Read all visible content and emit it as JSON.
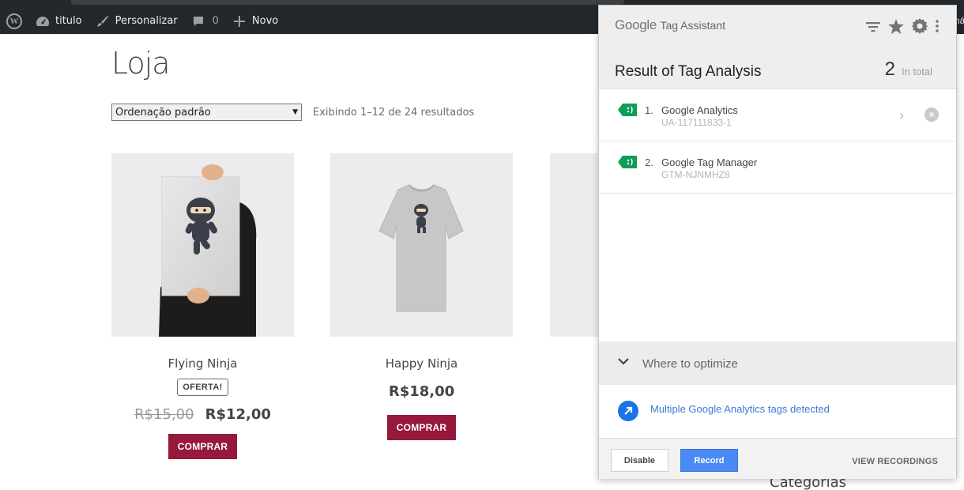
{
  "adminbar": {
    "wp_logo": "W",
    "site_label": "titulo",
    "customize_label": "Personalizar",
    "comments_count": "0",
    "new_label": "Novo",
    "right_edge_text": "ná",
    "icons": [
      "wordpress-logo-icon",
      "dashboard-icon",
      "brush-icon",
      "comment-icon",
      "plus-icon"
    ]
  },
  "shop": {
    "title": "Loja",
    "sort_selected": "Ordenação padrão",
    "result_count": "Exibindo 1–12 de 24 resultados",
    "buy_color": "#96183b",
    "products": [
      {
        "name": "Flying Ninja",
        "badge": "OFERTA!",
        "old_price": "R$15,00",
        "price": "R$12,00",
        "button": "COMPRAR"
      },
      {
        "name": "Happy Ninja",
        "price": "R$18,00",
        "button": "COMPRAR"
      }
    ],
    "sidebar_heading": "Categorias"
  },
  "tag_assistant": {
    "brand_google": "Google",
    "brand_product": "Tag Assistant",
    "title": "Result of Tag Analysis",
    "total_count": "2",
    "total_label": "In total",
    "header_icons": [
      "filter-icon",
      "star-icon",
      "settings-icon",
      "more-vert-icon"
    ],
    "tags": [
      {
        "index": "1.",
        "name": "Google Analytics",
        "id": "UA-117111833-1"
      },
      {
        "index": "2.",
        "name": "Google Tag Manager",
        "id": "GTM-NJNMHZ8"
      }
    ],
    "tag_icon_color": "#0f9d58",
    "optimize_label": "Where to optimize",
    "suggestion": "Multiple Google Analytics tags detected",
    "footer": {
      "disable": "Disable",
      "record": "Record",
      "view_recordings": "VIEW RECORDINGS"
    },
    "record_color": "#4a8af4"
  }
}
